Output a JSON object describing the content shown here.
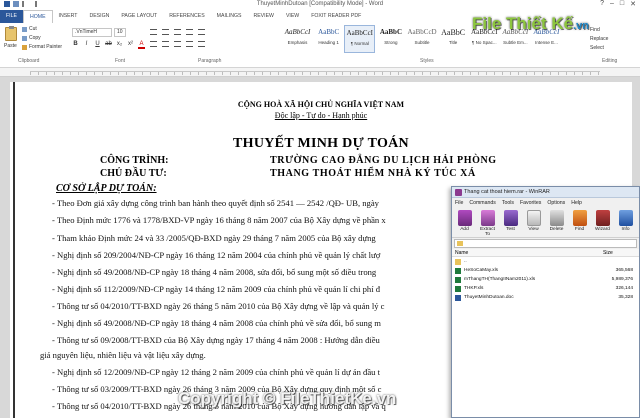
{
  "window": {
    "title": "ThuyetMinhDutoan [Compatibility Mode] - Word"
  },
  "tabs": [
    "FILE",
    "HOME",
    "INSERT",
    "DESIGN",
    "PAGE LAYOUT",
    "REFERENCES",
    "MAILINGS",
    "REVIEW",
    "VIEW",
    "FOXIT READER PDF"
  ],
  "ribbon": {
    "paste": "Paste",
    "cut": "Cut",
    "copy": "Copy",
    "format_painter": "Format Painter",
    "clipboard_label": "Clipboard",
    "font_name": ".VnTimeH",
    "font_size": "10",
    "font_label": "Font",
    "paragraph_label": "Paragraph",
    "styles_label": "Styles",
    "editing_label": "Editing",
    "find": "Find",
    "replace": "Replace",
    "select": "Select",
    "styles": [
      {
        "sample": "AaBbCcI",
        "name": "Emphasis"
      },
      {
        "sample": "AaBbC",
        "name": "Heading 1"
      },
      {
        "sample": "AaBbCcI",
        "name": "¶ Normal"
      },
      {
        "sample": "AaBbC",
        "name": "Strong"
      },
      {
        "sample": "AaBbCcD",
        "name": "Subtitle"
      },
      {
        "sample": "AaBbC",
        "name": "Title"
      },
      {
        "sample": "AaBbCcI",
        "name": "¶ No Spac..."
      },
      {
        "sample": "AaBbCcI",
        "name": "Subtle Em..."
      },
      {
        "sample": "AaBbCcI",
        "name": "Intense E..."
      }
    ]
  },
  "document": {
    "nation": "CỘNG HOÀ XÃ HỘI CHỦ NGHĨA VIỆT NAM",
    "motto": "Độc lập - Tự do - Hạnh phúc",
    "heading": "THUYẾT MINH DỰ TOÁN",
    "project_label": "CÔNG TRÌNH:",
    "project_value": "TRƯỜNG CAO ĐẲNG DU LỊCH HẢI PHÒNG",
    "owner_label": "CHỦ ĐẦU TƯ:",
    "owner_value": "THANG THOÁT HIỂM NHÀ KÝ TÚC XÁ",
    "basis": "CƠ SỞ LẬP DỰ TOÁN:",
    "lines": [
      "- Theo Đơn giá xây dựng công trình ban hành theo quyết định số  2541  —  2542 /QĐ- UB, ngày",
      "- Theo Định mức 1776 và 1778/BXD-VP ngày 16 tháng 8 năm 2007 của Bộ Xây dựng về phần x",
      "- Tham khảo Định mức  24 và 33 /2005/QĐ-BXD ngày 29 tháng 7 năm 2005 của Bộ xây dựng",
      "- Nghị định số 209/2004/NĐ-CP ngày 16 tháng 12 năm 2004 của chính phủ về  quản lý chất lượ",
      "- Nghị định số 49/2008/NĐ-CP ngày 18 tháng 4 năm 2008, sửa đổi, bổ sung một số điều trong",
      "- Nghị định số 112/2009/NĐ-CP ngày 14 tháng 12 năm 2009 của chính phủ về quản lí chi phí đ",
      "- Thông tư số 04/2010/TT-BXD ngày 26 tháng 5 năm 2010 của Bộ Xây dựng về lập và quản lý c",
      "- Nghị định số 49/2008/NĐ-CP ngày 18 tháng 4 năm 2008 của chính phủ về sửa đổi, bổ sung m",
      "- Thông tư số  09/2008/TT-BXD của Bộ Xây dựng ngày 17 tháng 4 năm 2008 :  Hướng dẫn điều",
      "giá nguyên liệu, nhiên liệu và vật liệu xây dựng.",
      "- Nghị định số 12/2009/NĐ-CP ngày 12 tháng 2 năm 2009 của chính phủ về quản lí dự án đầu t",
      "- Thông tư số 03/2009/TT-BXD ngày 26 tháng 3 năm 2009 của Bộ Xây dựng quy định một số c",
      "- Thông tư số 04/2010/TT-BXD ngày 26 tháng 5 năm 2010 của Bộ Xây dựng hướng dẫn lập và q"
    ]
  },
  "winrar": {
    "title": "Thang cat thoat hiem.rar - WinRAR",
    "menu": [
      "File",
      "Commands",
      "Tools",
      "Favorites",
      "Options",
      "Help"
    ],
    "tools": [
      "Add",
      "Extract To",
      "Test",
      "View",
      "Delete",
      "Find",
      "Wizard",
      "Info"
    ],
    "path": "",
    "col_name": "Name",
    "col_size": "Size",
    "files": [
      {
        "name": "..",
        "size": ""
      },
      {
        "name": "HeSoCaMay.xls",
        "size": "365,568"
      },
      {
        "name": "mThangTH(ThangIINam2011).xls",
        "size": "5,989,376"
      },
      {
        "name": "THKP.xls",
        "size": "326,144"
      },
      {
        "name": "ThuyetMinhDutoan.doc",
        "size": "35,328"
      }
    ]
  },
  "watermark": {
    "logo": "File Thiết Kế",
    "logo_domain": ".vn",
    "copyright": "Copyright © FileThietKe.vn"
  },
  "colors": {
    "word_blue": "#2b579a",
    "watermark_green": "#8dc63f",
    "watermark_blue": "#1e88c9"
  }
}
